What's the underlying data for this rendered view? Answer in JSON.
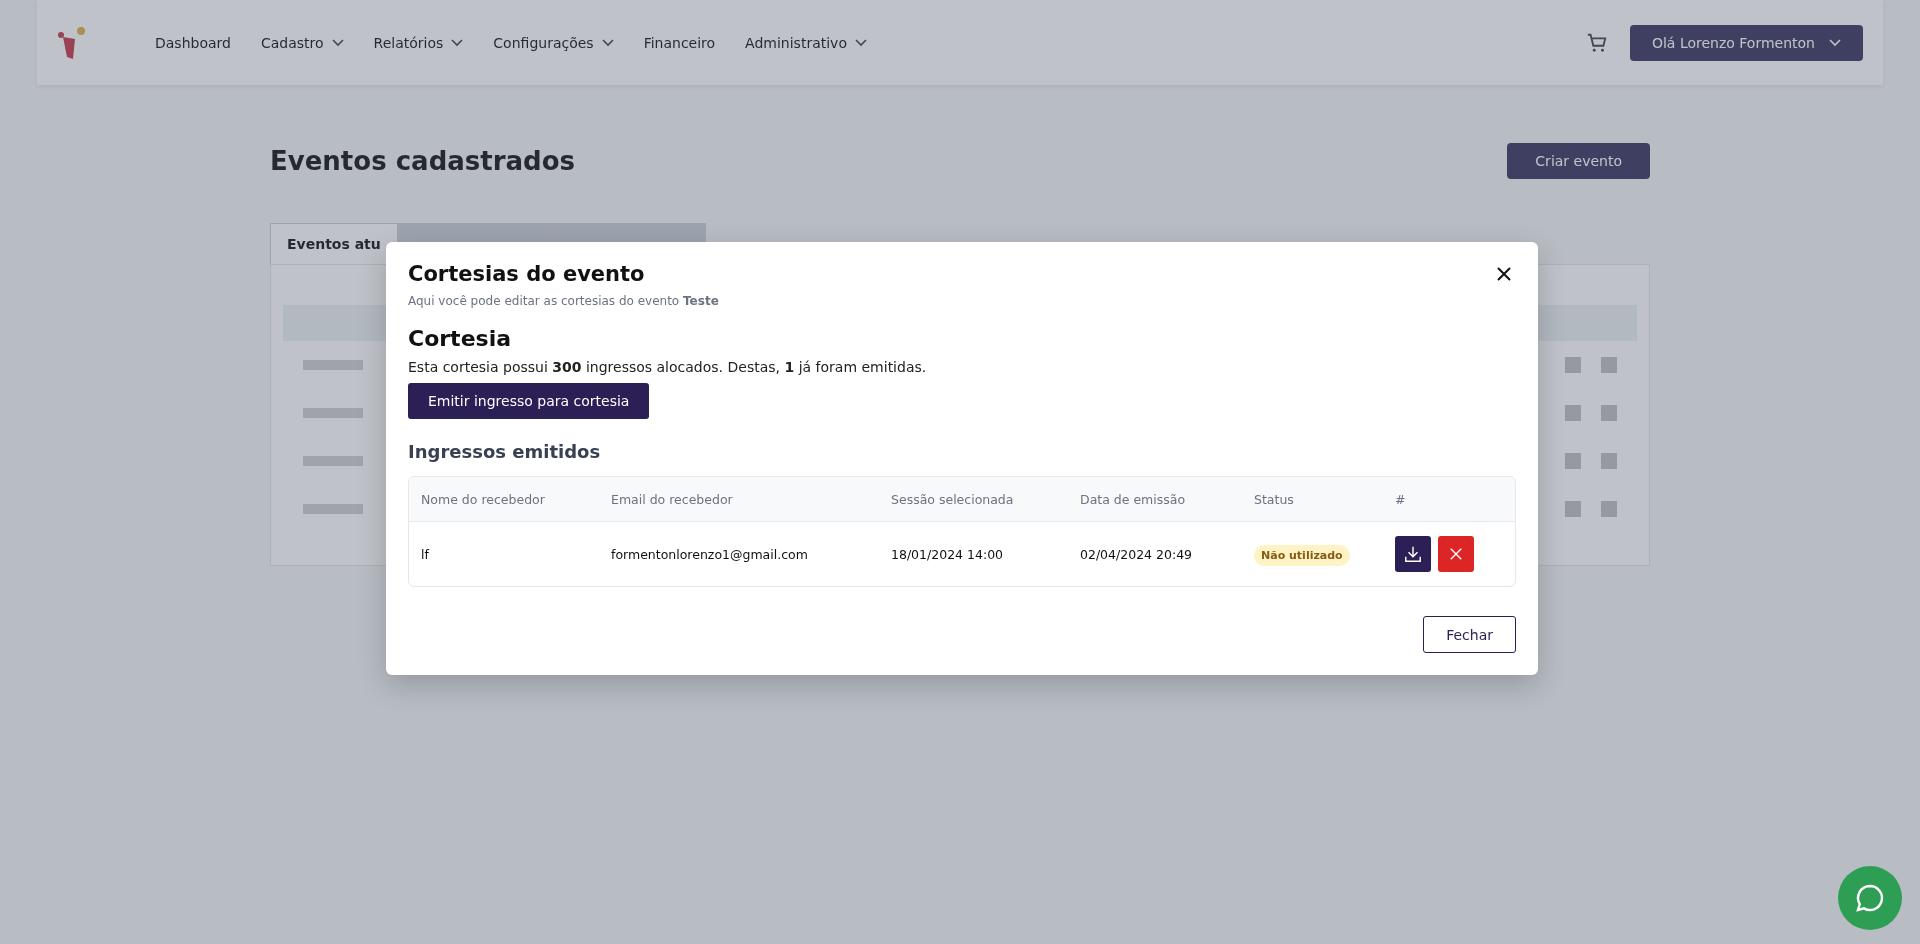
{
  "header": {
    "nav": [
      {
        "label": "Dashboard",
        "dropdown": false
      },
      {
        "label": "Cadastro",
        "dropdown": true
      },
      {
        "label": "Relatórios",
        "dropdown": true
      },
      {
        "label": "Configurações",
        "dropdown": true
      },
      {
        "label": "Financeiro",
        "dropdown": false
      },
      {
        "label": "Administrativo",
        "dropdown": true
      }
    ],
    "user_menu": "Olá Lorenzo Formenton"
  },
  "page": {
    "title": "Eventos cadastrados",
    "create_button": "Criar evento",
    "tabs": [
      {
        "label": "Eventos atu",
        "selected": true
      }
    ]
  },
  "modal": {
    "title": "Cortesias do evento",
    "subtitle": "Aqui você pode editar as cortesias do evento **Teste**",
    "section_title": "Cortesia",
    "summary": "Esta cortesia possui **300** ingressos alocados. Destas, **1** já foram emitidas.",
    "issue_button": "Emitir ingresso para cortesia",
    "list_title": "Ingressos emitidos",
    "columns": [
      "Nome do recebedor",
      "Email do recebedor",
      "Sessão selecionada",
      "Data de emissão",
      "Status",
      "#"
    ],
    "rows": [
      {
        "name": "lf",
        "email": "formentonlorenzo1@gmail.com",
        "session": "18/01/2024 14:00",
        "issued_at": "02/04/2024 20:49",
        "status": "Não utilizado"
      }
    ],
    "close_button": "Fechar"
  }
}
